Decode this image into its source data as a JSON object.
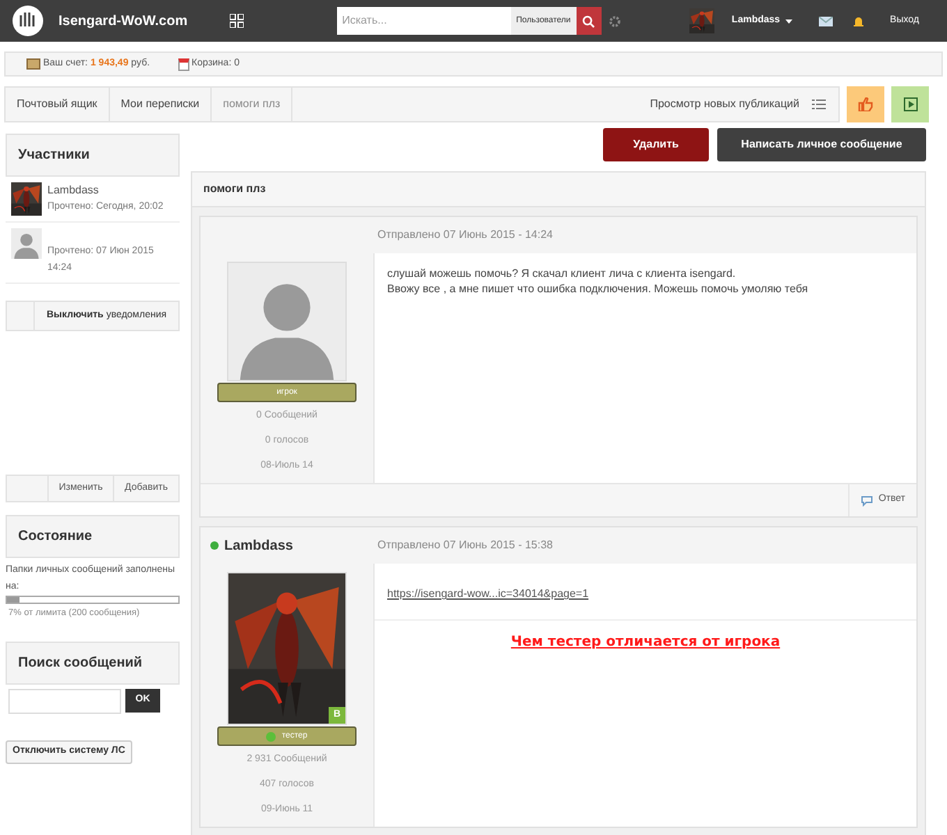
{
  "header": {
    "site": "Isengard-WoW.com",
    "search": {
      "placeholder": "Искать...",
      "scope": "Пользователи"
    },
    "user": "Lambdass",
    "logout": "Выход"
  },
  "account": {
    "balance_label": "Ваш счет:",
    "balance": "1 943,49",
    "currency": "руб.",
    "cart": "Корзина: 0"
  },
  "breadcrumb": [
    "Почтовый ящик",
    "Мои переписки",
    "помоги плз"
  ],
  "new_posts": "Просмотр новых публикаций",
  "sidebar": {
    "participants_title": "Участники",
    "participants": [
      {
        "name": "Lambdass",
        "kind": "picture",
        "read": "Прочтено: Сегодня, 20:02"
      },
      {
        "kind": "blank",
        "read": "Прочтено: 07 Июн 2015 14:24"
      }
    ],
    "notify": {
      "bold": "Выключить",
      "rest": "уведомления"
    },
    "edit": "Изменить",
    "add": "Добавить",
    "status_title": "Состояние",
    "status_text": "Папки личных сообщений заполнены на:",
    "level": 0.07,
    "limit": "7% от лимита (200 сообщения)",
    "search_title": "Поиск сообщений",
    "ok": "OK",
    "disable": "Отключить систему ЛС"
  },
  "actions": {
    "delete": "Удалить",
    "write": "Написать личное сообщение"
  },
  "topic": "помоги плз",
  "posts": [
    {
      "online": false,
      "kind": "blank",
      "date": "Отправлено 07 Июнь 2015 - 14:24",
      "rank": "игрок",
      "rank_icon": false,
      "stats": [
        "0 Сообщений",
        "0 голосов",
        "08-Июль 14"
      ],
      "lines": [
        "слушай можешь помочь? Я скачал клиент лича с клиента isengard.",
        "Ввожу все , а мне пишет что ошибка подключения. Можешь помочь умоляю тебя"
      ],
      "reply": "Ответ"
    },
    {
      "author": "Lambdass",
      "online": true,
      "kind": "picture",
      "date": "Отправлено 07 Июнь 2015 - 15:38",
      "rank": "тестер",
      "rank_icon": true,
      "badge": "B",
      "stats": [
        "2 931 Сообщений",
        "407 голосов",
        "09-Июнь 11"
      ],
      "link": "https://isengard-wow...ic=34014&page=1",
      "headline": "Чем тестер отличается от игрока"
    }
  ]
}
